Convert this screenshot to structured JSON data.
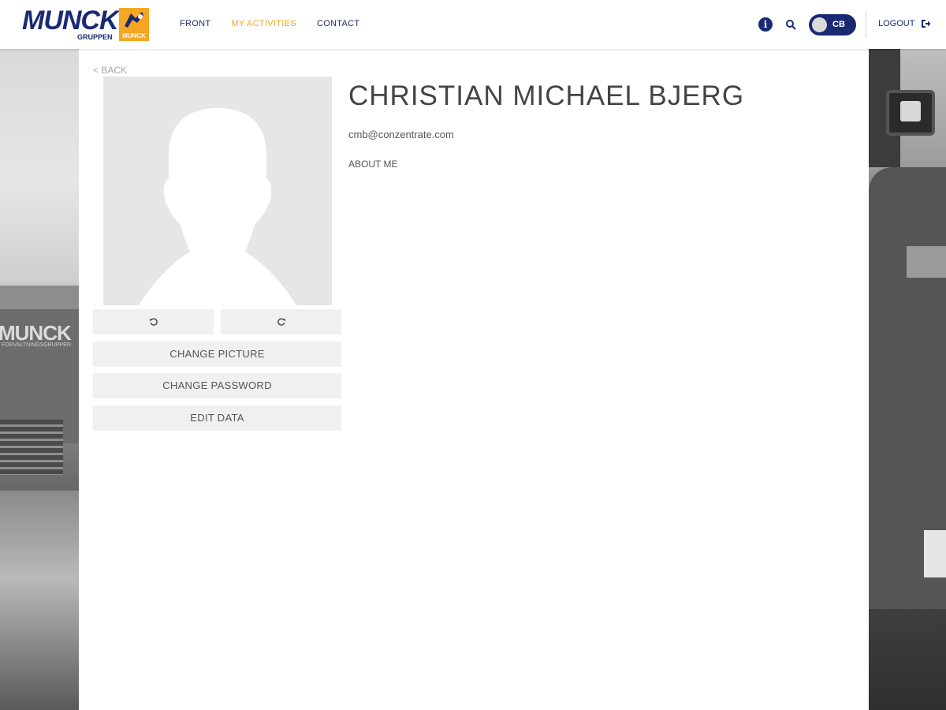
{
  "header": {
    "logo_text": "MUNCK",
    "logo_sub": "GRUPPEN",
    "logo_badge_text": "MUNCK",
    "nav": [
      {
        "label": "FRONT",
        "active": false
      },
      {
        "label": "MY ACTIVITIES",
        "active": true
      },
      {
        "label": "CONTACT",
        "active": false
      }
    ],
    "user_initials": "CB",
    "logout_label": "LOGOUT"
  },
  "colors": {
    "brand_navy": "#1a2a72",
    "accent_orange": "#f5a623"
  },
  "background": {
    "watermark_brand": "MUNCK",
    "watermark_sub": "FORVALTNINGSGRUPPEN"
  },
  "profile": {
    "back_label": "< BACK",
    "name": "CHRISTIAN MICHAEL BJERG",
    "email": "cmb@conzentrate.com",
    "about_label": "ABOUT ME",
    "rotate_left_icon": "rotate-left-icon",
    "rotate_right_icon": "rotate-right-icon",
    "buttons": {
      "change_picture": "CHANGE PICTURE",
      "change_password": "CHANGE PASSWORD",
      "edit_data": "EDIT DATA"
    }
  }
}
